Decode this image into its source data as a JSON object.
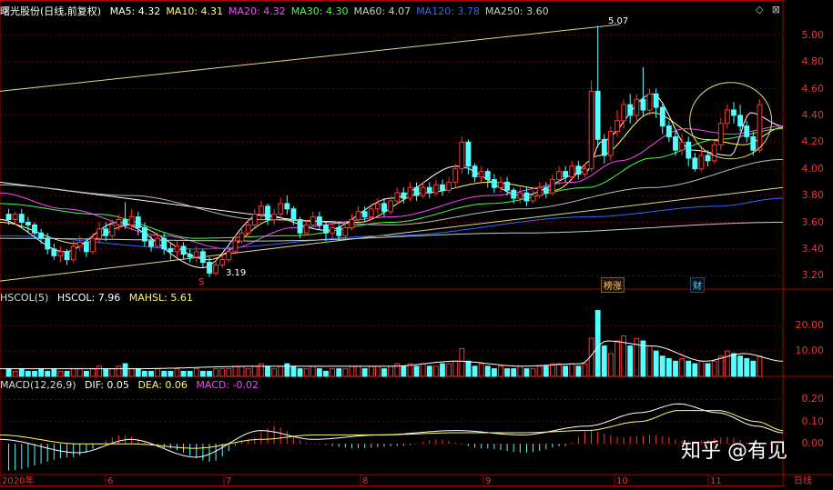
{
  "header_main": {
    "stock": "曙光股份(日线,前复权)",
    "ma": [
      {
        "label": "MA5: 4.32",
        "color": "#ffffff"
      },
      {
        "label": "MA10: 4.31",
        "color": "#ffff66"
      },
      {
        "label": "MA20: 4.32",
        "color": "#ff44ff"
      },
      {
        "label": "MA30: 4.30",
        "color": "#44ff44"
      },
      {
        "label": "MA60: 4.07",
        "color": "#cccccc"
      },
      {
        "label": "MA120: 3.78",
        "color": "#3366ff"
      },
      {
        "label": "MA250: 3.60",
        "color": "#cccccc"
      }
    ]
  },
  "header_vol": {
    "name": "HSCOL(5)",
    "v1": "HSCOL: 7.96",
    "v2": "MAHSL: 5.61"
  },
  "header_macd": {
    "name": "MACD(12,26,9)",
    "dif": "DIF: 0.05",
    "dea": "DEA: 0.06",
    "macd": "MACD: -0.02"
  },
  "price_axis": [
    "5.00",
    "4.80",
    "4.60",
    "4.40",
    "4.20",
    "4.00",
    "3.80",
    "3.60",
    "3.40",
    "3.20"
  ],
  "vol_axis": [
    "20.00",
    "10.00"
  ],
  "macd_axis": [
    "0.20",
    "0.10",
    "0.00"
  ],
  "x_axis": [
    "2020年",
    "6",
    "7",
    "8",
    "9",
    "10",
    "11",
    "日线"
  ],
  "annotations": {
    "high": "5.07",
    "low": "3.19",
    "tag1": "榜涨",
    "tag2": "财",
    "marker": "S"
  },
  "watermark": "知乎 @有见",
  "colors": {
    "up": "#ff3333",
    "down": "#55ffff",
    "grid": "#7a0000",
    "axis": "#e33333"
  },
  "chart_data": {
    "type": "candlestick",
    "x_range": [
      0,
      120
    ],
    "y_range": [
      3.1,
      5.1
    ],
    "candles": [
      [
        3.66,
        3.62,
        3.7,
        3.58
      ],
      [
        3.62,
        3.66,
        3.68,
        3.58
      ],
      [
        3.66,
        3.6,
        3.7,
        3.56
      ],
      [
        3.6,
        3.58,
        3.64,
        3.52
      ],
      [
        3.58,
        3.52,
        3.6,
        3.48
      ],
      [
        3.52,
        3.48,
        3.55,
        3.44
      ],
      [
        3.48,
        3.4,
        3.52,
        3.36
      ],
      [
        3.4,
        3.35,
        3.44,
        3.32
      ],
      [
        3.35,
        3.38,
        3.42,
        3.3
      ],
      [
        3.38,
        3.32,
        3.4,
        3.28
      ],
      [
        3.32,
        3.42,
        3.46,
        3.3
      ],
      [
        3.42,
        3.45,
        3.5,
        3.38
      ],
      [
        3.45,
        3.38,
        3.48,
        3.34
      ],
      [
        3.38,
        3.48,
        3.52,
        3.36
      ],
      [
        3.48,
        3.55,
        3.6,
        3.44
      ],
      [
        3.55,
        3.5,
        3.6,
        3.46
      ],
      [
        3.5,
        3.58,
        3.62,
        3.48
      ],
      [
        3.58,
        3.62,
        3.66,
        3.54
      ],
      [
        3.62,
        3.58,
        3.75,
        3.55
      ],
      [
        3.58,
        3.64,
        3.7,
        3.54
      ],
      [
        3.64,
        3.56,
        3.68,
        3.5
      ],
      [
        3.56,
        3.46,
        3.6,
        3.42
      ],
      [
        3.46,
        3.42,
        3.5,
        3.38
      ],
      [
        3.42,
        3.48,
        3.52,
        3.4
      ],
      [
        3.48,
        3.4,
        3.52,
        3.36
      ],
      [
        3.4,
        3.38,
        3.44,
        3.32
      ],
      [
        3.38,
        3.42,
        3.46,
        3.34
      ],
      [
        3.42,
        3.36,
        3.45,
        3.32
      ],
      [
        3.36,
        3.34,
        3.4,
        3.3
      ],
      [
        3.34,
        3.38,
        3.42,
        3.3
      ],
      [
        3.38,
        3.3,
        3.4,
        3.26
      ],
      [
        3.3,
        3.22,
        3.34,
        3.19
      ],
      [
        3.22,
        3.28,
        3.32,
        3.2
      ],
      [
        3.28,
        3.32,
        3.36,
        3.26
      ],
      [
        3.32,
        3.38,
        3.42,
        3.3
      ],
      [
        3.38,
        3.46,
        3.5,
        3.36
      ],
      [
        3.46,
        3.52,
        3.56,
        3.44
      ],
      [
        3.52,
        3.58,
        3.62,
        3.5
      ],
      [
        3.58,
        3.66,
        3.7,
        3.56
      ],
      [
        3.66,
        3.72,
        3.76,
        3.62
      ],
      [
        3.72,
        3.62,
        3.74,
        3.58
      ],
      [
        3.62,
        3.66,
        3.7,
        3.58
      ],
      [
        3.66,
        3.74,
        3.78,
        3.64
      ],
      [
        3.74,
        3.7,
        3.8,
        3.66
      ],
      [
        3.7,
        3.62,
        3.72,
        3.58
      ],
      [
        3.62,
        3.52,
        3.64,
        3.48
      ],
      [
        3.52,
        3.58,
        3.62,
        3.5
      ],
      [
        3.58,
        3.64,
        3.68,
        3.56
      ],
      [
        3.64,
        3.58,
        3.68,
        3.54
      ],
      [
        3.58,
        3.52,
        3.6,
        3.46
      ],
      [
        3.52,
        3.56,
        3.6,
        3.48
      ],
      [
        3.56,
        3.5,
        3.6,
        3.46
      ],
      [
        3.5,
        3.56,
        3.6,
        3.48
      ],
      [
        3.56,
        3.62,
        3.66,
        3.54
      ],
      [
        3.62,
        3.68,
        3.72,
        3.6
      ],
      [
        3.68,
        3.64,
        3.72,
        3.6
      ],
      [
        3.64,
        3.7,
        3.74,
        3.62
      ],
      [
        3.7,
        3.74,
        3.78,
        3.66
      ],
      [
        3.74,
        3.68,
        3.78,
        3.64
      ],
      [
        3.68,
        3.76,
        3.8,
        3.66
      ],
      [
        3.76,
        3.82,
        3.86,
        3.74
      ],
      [
        3.82,
        3.78,
        3.86,
        3.74
      ],
      [
        3.78,
        3.86,
        3.9,
        3.76
      ],
      [
        3.86,
        3.8,
        3.9,
        3.76
      ],
      [
        3.8,
        3.86,
        3.9,
        3.78
      ],
      [
        3.86,
        3.82,
        3.9,
        3.78
      ],
      [
        3.82,
        3.88,
        3.92,
        3.8
      ],
      [
        3.88,
        3.84,
        3.92,
        3.8
      ],
      [
        3.84,
        3.9,
        3.94,
        3.82
      ],
      [
        3.9,
        4.0,
        4.04,
        3.86
      ],
      [
        4.0,
        4.2,
        4.24,
        3.96
      ],
      [
        4.2,
        4.02,
        4.22,
        3.96
      ],
      [
        4.02,
        3.94,
        4.04,
        3.9
      ],
      [
        3.94,
        3.98,
        4.02,
        3.9
      ],
      [
        3.98,
        3.92,
        4.0,
        3.86
      ],
      [
        3.92,
        3.86,
        3.96,
        3.82
      ],
      [
        3.86,
        3.9,
        3.94,
        3.82
      ],
      [
        3.9,
        3.84,
        3.94,
        3.8
      ],
      [
        3.84,
        3.78,
        3.86,
        3.74
      ],
      [
        3.78,
        3.82,
        3.86,
        3.74
      ],
      [
        3.82,
        3.76,
        3.86,
        3.72
      ],
      [
        3.76,
        3.8,
        3.84,
        3.74
      ],
      [
        3.8,
        3.86,
        3.9,
        3.78
      ],
      [
        3.86,
        3.82,
        3.9,
        3.78
      ],
      [
        3.82,
        3.92,
        3.96,
        3.8
      ],
      [
        3.92,
        3.98,
        4.02,
        3.88
      ],
      [
        3.98,
        3.94,
        4.02,
        3.9
      ],
      [
        3.94,
        4.02,
        4.06,
        3.92
      ],
      [
        4.02,
        3.96,
        4.06,
        3.92
      ],
      [
        3.96,
        4.0,
        4.04,
        3.94
      ],
      [
        4.0,
        4.58,
        4.66,
        3.98
      ],
      [
        4.58,
        4.22,
        5.07,
        4.16
      ],
      [
        4.22,
        4.1,
        4.26,
        4.04
      ],
      [
        4.1,
        4.28,
        4.32,
        4.06
      ],
      [
        4.28,
        4.36,
        4.44,
        4.24
      ],
      [
        4.36,
        4.48,
        4.52,
        4.3
      ],
      [
        4.48,
        4.4,
        4.56,
        4.34
      ],
      [
        4.4,
        4.52,
        4.56,
        4.36
      ],
      [
        4.52,
        4.44,
        4.76,
        4.4
      ],
      [
        4.44,
        4.56,
        4.6,
        4.4
      ],
      [
        4.56,
        4.46,
        4.6,
        4.38
      ],
      [
        4.46,
        4.32,
        4.5,
        4.26
      ],
      [
        4.32,
        4.24,
        4.36,
        4.2
      ],
      [
        4.24,
        4.14,
        4.3,
        4.1
      ],
      [
        4.14,
        4.2,
        4.26,
        4.1
      ],
      [
        4.2,
        4.08,
        4.24,
        4.02
      ],
      [
        4.08,
        4.0,
        4.12,
        3.98
      ],
      [
        4.0,
        4.1,
        4.16,
        3.98
      ],
      [
        4.1,
        4.06,
        4.14,
        4.02
      ],
      [
        4.06,
        4.18,
        4.22,
        4.04
      ],
      [
        4.18,
        4.34,
        4.38,
        4.14
      ],
      [
        4.34,
        4.44,
        4.48,
        4.3
      ],
      [
        4.44,
        4.4,
        4.5,
        4.34
      ],
      [
        4.4,
        4.32,
        4.48,
        4.28
      ],
      [
        4.32,
        4.24,
        4.36,
        4.2
      ],
      [
        4.24,
        4.14,
        4.28,
        4.1
      ],
      [
        4.14,
        4.48,
        4.52,
        4.12
      ]
    ],
    "ma_lines": {
      "MA5": {
        "color": "#ffffff",
        "anchors": [
          [
            0,
            3.62
          ],
          [
            10,
            3.38
          ],
          [
            18,
            3.6
          ],
          [
            31,
            3.26
          ],
          [
            40,
            3.66
          ],
          [
            50,
            3.54
          ],
          [
            60,
            3.78
          ],
          [
            70,
            4.02
          ],
          [
            80,
            3.8
          ],
          [
            90,
            3.98
          ],
          [
            92,
            4.2
          ],
          [
            100,
            4.56
          ],
          [
            106,
            4.14
          ],
          [
            112,
            4.1
          ],
          [
            115,
            4.42
          ],
          [
            120,
            4.32
          ]
        ]
      },
      "MA10": {
        "color": "#ffff66",
        "anchors": [
          [
            0,
            3.6
          ],
          [
            12,
            3.44
          ],
          [
            20,
            3.58
          ],
          [
            32,
            3.32
          ],
          [
            42,
            3.62
          ],
          [
            55,
            3.6
          ],
          [
            65,
            3.82
          ],
          [
            75,
            3.9
          ],
          [
            85,
            3.84
          ],
          [
            92,
            4.1
          ],
          [
            100,
            4.42
          ],
          [
            108,
            4.22
          ],
          [
            114,
            4.18
          ],
          [
            120,
            4.31
          ]
        ]
      },
      "MA20": {
        "color": "#ff44ff",
        "anchors": [
          [
            0,
            3.82
          ],
          [
            10,
            3.7
          ],
          [
            25,
            3.5
          ],
          [
            35,
            3.4
          ],
          [
            45,
            3.56
          ],
          [
            60,
            3.64
          ],
          [
            75,
            3.8
          ],
          [
            88,
            3.9
          ],
          [
            95,
            4.06
          ],
          [
            105,
            4.3
          ],
          [
            112,
            4.26
          ],
          [
            120,
            4.32
          ]
        ]
      },
      "MA30": {
        "color": "#44ff44",
        "anchors": [
          [
            0,
            3.74
          ],
          [
            15,
            3.66
          ],
          [
            30,
            3.48
          ],
          [
            45,
            3.5
          ],
          [
            60,
            3.6
          ],
          [
            75,
            3.74
          ],
          [
            90,
            3.86
          ],
          [
            100,
            4.08
          ],
          [
            110,
            4.22
          ],
          [
            120,
            4.3
          ]
        ]
      },
      "MA60": {
        "color": "#bbbbbb",
        "anchors": [
          [
            0,
            3.88
          ],
          [
            20,
            3.8
          ],
          [
            40,
            3.62
          ],
          [
            60,
            3.58
          ],
          [
            80,
            3.7
          ],
          [
            100,
            3.86
          ],
          [
            120,
            4.07
          ]
        ]
      },
      "MA120": {
        "color": "#3366ff",
        "anchors": [
          [
            0,
            3.5
          ],
          [
            30,
            3.4
          ],
          [
            60,
            3.5
          ],
          [
            90,
            3.64
          ],
          [
            110,
            3.72
          ],
          [
            120,
            3.78
          ]
        ]
      },
      "MA250": {
        "color": "#cccccc",
        "anchors": [
          [
            0,
            3.48
          ],
          [
            40,
            3.46
          ],
          [
            80,
            3.52
          ],
          [
            120,
            3.6
          ]
        ]
      }
    },
    "trend_lines": [
      {
        "color": "#dddd88",
        "from": [
          0,
          4.58
        ],
        "to": [
          95,
          5.08
        ]
      },
      {
        "color": "#dddd88",
        "from": [
          0,
          3.16
        ],
        "to": [
          120,
          3.86
        ]
      },
      {
        "color": "#ffffff",
        "from": [
          0,
          3.9
        ],
        "to": [
          45,
          3.62
        ]
      }
    ],
    "volume": {
      "values": [
        3,
        2,
        3,
        2,
        2,
        3,
        2,
        3,
        2,
        2,
        3,
        3,
        2,
        3,
        4,
        3,
        3,
        4,
        5,
        3,
        3,
        2,
        2,
        3,
        2,
        2,
        3,
        2,
        2,
        3,
        2,
        2,
        3,
        3,
        3,
        4,
        4,
        3,
        4,
        5,
        4,
        3,
        4,
        5,
        4,
        3,
        3,
        4,
        3,
        2,
        3,
        3,
        3,
        4,
        4,
        3,
        4,
        4,
        3,
        4,
        5,
        4,
        5,
        4,
        5,
        4,
        4,
        5,
        5,
        6,
        11,
        6,
        4,
        5,
        4,
        3,
        4,
        3,
        3,
        4,
        3,
        3,
        4,
        4,
        5,
        5,
        4,
        5,
        4,
        5,
        15,
        26,
        12,
        9,
        14,
        16,
        12,
        15,
        14,
        12,
        10,
        8,
        7,
        6,
        7,
        6,
        5,
        6,
        5,
        6,
        8,
        10,
        9,
        8,
        7,
        6,
        8
      ],
      "ma_anchors": [
        [
          0,
          3
        ],
        [
          20,
          3
        ],
        [
          40,
          4
        ],
        [
          60,
          4
        ],
        [
          70,
          6
        ],
        [
          80,
          4
        ],
        [
          89,
          5
        ],
        [
          93,
          14
        ],
        [
          100,
          12
        ],
        [
          108,
          6
        ],
        [
          114,
          9
        ],
        [
          120,
          6
        ]
      ]
    },
    "macd": {
      "hist_anchors": [
        [
          0,
          -0.12
        ],
        [
          10,
          -0.06
        ],
        [
          18,
          0.04
        ],
        [
          25,
          -0.02
        ],
        [
          32,
          -0.08
        ],
        [
          38,
          0.02
        ],
        [
          42,
          0.08
        ],
        [
          48,
          0.0
        ],
        [
          55,
          -0.02
        ],
        [
          62,
          -0.01
        ],
        [
          68,
          0.02
        ],
        [
          75,
          -0.02
        ],
        [
          82,
          -0.04
        ],
        [
          88,
          -0.01
        ],
        [
          92,
          0.06
        ],
        [
          97,
          0.03
        ],
        [
          102,
          0.04
        ],
        [
          108,
          0.01
        ],
        [
          114,
          0.03
        ],
        [
          120,
          -0.02
        ]
      ],
      "dif_anchors": [
        [
          0,
          0.02
        ],
        [
          12,
          -0.04
        ],
        [
          20,
          0.02
        ],
        [
          30,
          -0.06
        ],
        [
          40,
          0.06
        ],
        [
          48,
          0.02
        ],
        [
          58,
          0.04
        ],
        [
          70,
          0.06
        ],
        [
          80,
          0.04
        ],
        [
          90,
          0.08
        ],
        [
          98,
          0.14
        ],
        [
          104,
          0.18
        ],
        [
          110,
          0.14
        ],
        [
          116,
          0.08
        ],
        [
          120,
          0.05
        ]
      ],
      "dea_anchors": [
        [
          0,
          0.04
        ],
        [
          12,
          0.0
        ],
        [
          20,
          0.0
        ],
        [
          30,
          -0.02
        ],
        [
          40,
          0.02
        ],
        [
          48,
          0.04
        ],
        [
          58,
          0.04
        ],
        [
          70,
          0.05
        ],
        [
          80,
          0.05
        ],
        [
          90,
          0.06
        ],
        [
          98,
          0.1
        ],
        [
          104,
          0.15
        ],
        [
          110,
          0.15
        ],
        [
          116,
          0.1
        ],
        [
          120,
          0.06
        ]
      ],
      "y_range": [
        -0.13,
        0.23
      ]
    }
  }
}
